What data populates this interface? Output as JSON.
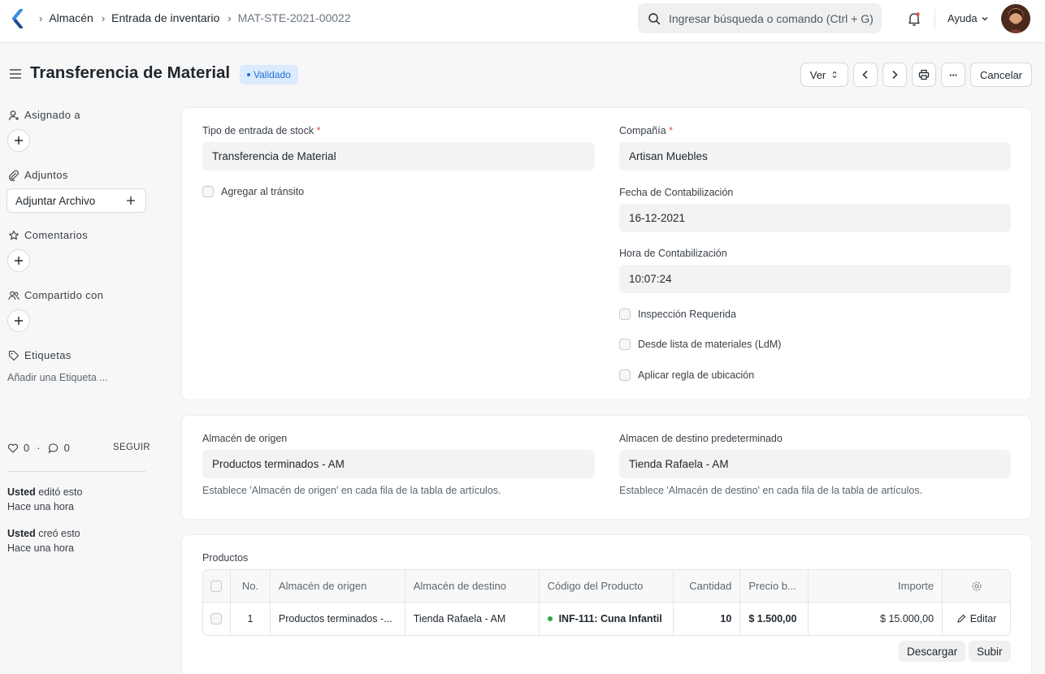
{
  "navbar": {
    "breadcrumbs": [
      "Almacén",
      "Entrada de inventario",
      "MAT-STE-2021-00022"
    ],
    "search_placeholder": "Ingresar búsqueda o comando (Ctrl + G)",
    "help_label": "Ayuda"
  },
  "page": {
    "title": "Transferencia de Material",
    "status": "Validado",
    "view_label": "Ver",
    "more_label": "···",
    "cancel_label": "Cancelar"
  },
  "sidebar": {
    "assigned_label": "Asignado a",
    "attachments_label": "Adjuntos",
    "attach_button": "Adjuntar Archivo",
    "comments_label": "Comentarios",
    "shared_label": "Compartido con",
    "tags_label": "Etiquetas",
    "tags_hint": "Añadir una Etiqueta ...",
    "likes": "0",
    "comments_count": "0",
    "separator": "·",
    "follow": "SEGUIR",
    "activity": [
      {
        "user": "Usted",
        "action": "editó esto",
        "time": "Hace una hora"
      },
      {
        "user": "Usted",
        "action": "creó esto",
        "time": "Hace una hora"
      }
    ]
  },
  "form": {
    "stock_entry_type_label": "Tipo de entrada de stock",
    "stock_entry_type_value": "Transferencia de Material",
    "add_to_transit_label": "Agregar al tránsito",
    "company_label": "Compañía",
    "company_value": "Artisan Muebles",
    "posting_date_label": "Fecha de Contabilización",
    "posting_date_value": "16-12-2021",
    "posting_time_label": "Hora de Contabilización",
    "posting_time_value": "10:07:24",
    "inspection_label": "Inspección Requerida",
    "from_bom_label": "Desde lista de materiales (LdM)",
    "putaway_label": "Aplicar regla de ubicación",
    "required_mark": "*"
  },
  "warehouses": {
    "source_label": "Almacén de origen",
    "source_value": "Productos terminados - AM",
    "source_desc": "Establece 'Almacén de origen' en cada fila de la tabla de artículos.",
    "target_label": "Almacen de destino predeterminado",
    "target_value": "Tienda Rafaela - AM",
    "target_desc": "Establece 'Almacén de destino' en cada fila de la tabla de artículos."
  },
  "items": {
    "section_label": "Productos",
    "columns": [
      "No.",
      "Almacén de origen",
      "Almacén de destino",
      "Código del Producto",
      "Cantidad",
      "Precio b...",
      "Importe"
    ],
    "rows": [
      {
        "no": "1",
        "source": "Productos terminados -...",
        "target": "Tienda Rafaela - AM",
        "item_code": "INF-111: Cuna Infantil",
        "qty": "10",
        "rate": "$ 1.500,00",
        "amount": "$ 15.000,00",
        "edit": "Editar"
      }
    ],
    "download_label": "Descargar",
    "upload_label": "Subir"
  },
  "colors": {
    "accent": "#1d6fd8",
    "badge_bg": "#dbeafe",
    "status_green": "#28a745",
    "required_red": "#e24c4c"
  },
  "icons": [
    "app-logo-icon",
    "chevron-right-icon",
    "search-icon",
    "bell-icon",
    "chevron-down-icon",
    "hamburger-icon",
    "user-icon",
    "paperclip-icon",
    "star-icon",
    "users-icon",
    "tag-icon",
    "plus-icon",
    "heart-icon",
    "comment-icon",
    "printer-icon",
    "gear-icon",
    "pencil-icon"
  ]
}
